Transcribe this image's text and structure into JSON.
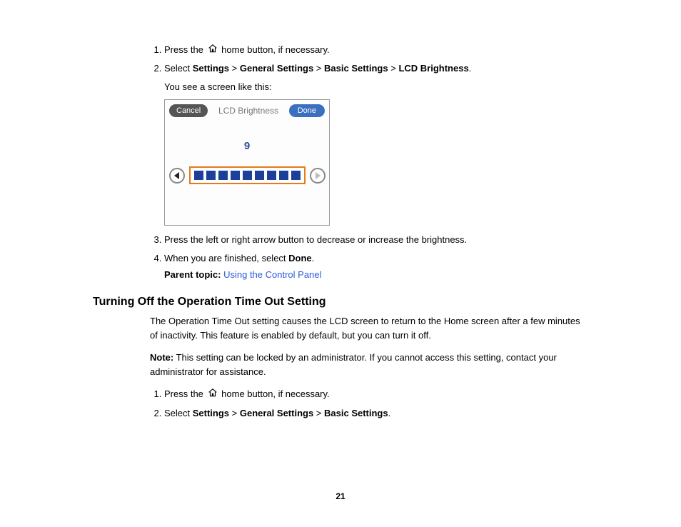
{
  "section1": {
    "step1_pre": "Press the ",
    "step1_post": " home button, if necessary.",
    "step2_pre": "Select ",
    "step2_b1": "Settings",
    "step2_gt": " > ",
    "step2_b2": "General Settings",
    "step2_b3": "Basic Settings",
    "step2_b4": "LCD Brightness",
    "step2_post": ".",
    "step2_sub": "You see a screen like this:",
    "step3": "Press the left or right arrow button to decrease or increase the brightness.",
    "step4_pre": "When you are finished, select ",
    "step4_b": "Done",
    "step4_post": ".",
    "parent_label": "Parent topic:",
    "parent_link": "Using the Control Panel"
  },
  "lcd": {
    "cancel": "Cancel",
    "title": "LCD Brightness",
    "done": "Done",
    "value": "9",
    "blocks": 9
  },
  "section2": {
    "heading": "Turning Off the Operation Time Out Setting",
    "para1": "The Operation Time Out setting causes the LCD screen to return to the Home screen after a few minutes of inactivity. This feature is enabled by default, but you can turn it off.",
    "note_label": "Note:",
    "note_text": " This setting can be locked by an administrator. If you cannot access this setting, contact your administrator for assistance.",
    "step1_pre": "Press the ",
    "step1_post": " home button, if necessary.",
    "step2_pre": "Select ",
    "step2_b1": "Settings",
    "step2_gt": " > ",
    "step2_b2": "General Settings",
    "step2_b3": "Basic Settings",
    "step2_post": "."
  },
  "page_number": "21"
}
